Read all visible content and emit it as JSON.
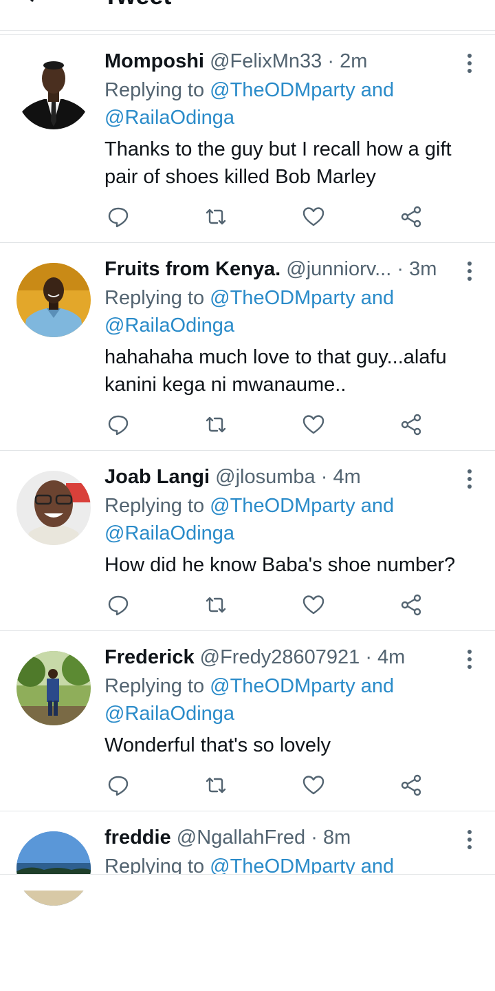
{
  "header": {
    "title": "Tweet"
  },
  "colors": {
    "accent": "#1d9bf0",
    "muted": "#536471",
    "text": "#0f1419"
  },
  "tweets": [
    {
      "name": "Momposhi",
      "handle": "@FelixMn33",
      "sep": "·",
      "time": "2m",
      "replying_prefix": "Replying to ",
      "replying_to": "@TheODMparty",
      "replying_and": " and",
      "replying_to2": "@RailaOdinga",
      "text": "Thanks to the guy but I recall how a gift pair of shoes killed Bob Marley"
    },
    {
      "name": "Fruits from Kenya.",
      "handle": "@junniorv...",
      "sep": "·",
      "time": "3m",
      "replying_prefix": "Replying to ",
      "replying_to": "@TheODMparty",
      "replying_and": " and",
      "replying_to2": "@RailaOdinga",
      "text": "hahahaha much love to that guy...alafu kanini kega ni mwanaume.."
    },
    {
      "name": "Joab Langi",
      "handle": "@jlosumba",
      "sep": "·",
      "time": "4m",
      "replying_prefix": "Replying to ",
      "replying_to": "@TheODMparty",
      "replying_and": " and",
      "replying_to2": "@RailaOdinga",
      "text": "How did he know Baba's shoe number?"
    },
    {
      "name": "Frederick",
      "handle": "@Fredy28607921",
      "sep": "·",
      "time": "4m",
      "replying_prefix": "Replying to ",
      "replying_to": "@TheODMparty",
      "replying_and": " and",
      "replying_to2": "@RailaOdinga",
      "text": "Wonderful that's so lovely"
    },
    {
      "name": "freddie",
      "handle": "@NgallahFred",
      "sep": "·",
      "time": "8m",
      "replying_prefix": "Replying to ",
      "replying_to": "@TheODMparty",
      "replying_and": " and"
    }
  ]
}
